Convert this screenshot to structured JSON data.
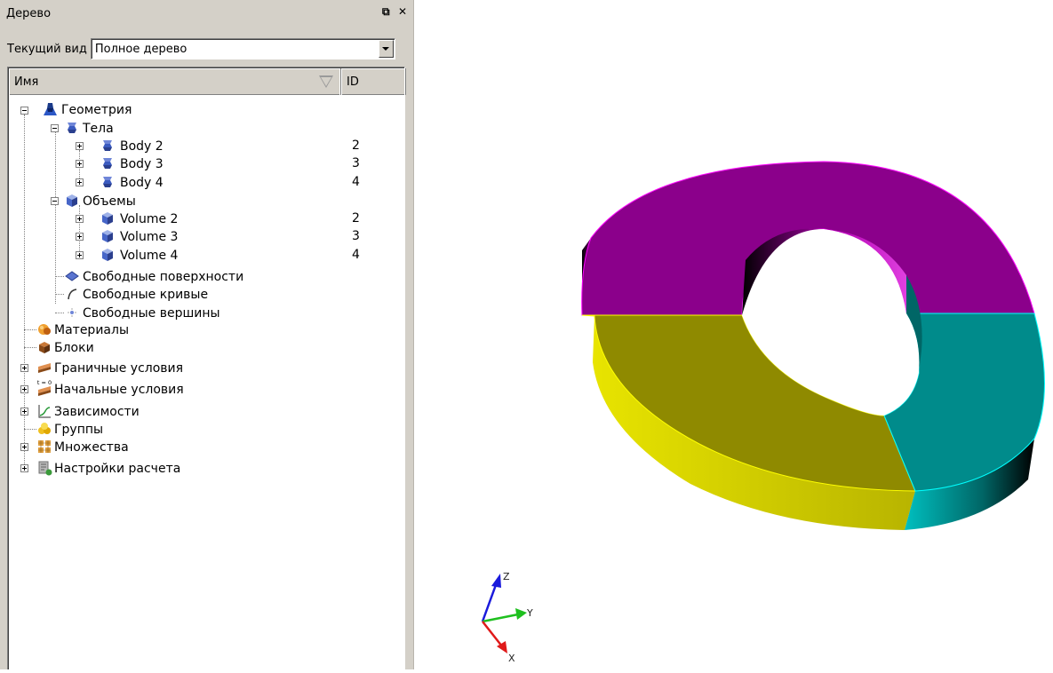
{
  "panel": {
    "title": "Дерево",
    "float_glyph": "⧉",
    "close_glyph": "✕",
    "view_label": "Текущий вид",
    "view_value": "Полное дерево"
  },
  "columns": {
    "name": "Имя",
    "id": "ID"
  },
  "tree": {
    "geometry": "Геометрия",
    "bodies": "Тела",
    "body2": {
      "label": "Body 2",
      "id": "2"
    },
    "body3": {
      "label": "Body 3",
      "id": "3"
    },
    "body4": {
      "label": "Body 4",
      "id": "4"
    },
    "volumes": "Объемы",
    "volume2": {
      "label": "Volume 2",
      "id": "2"
    },
    "volume3": {
      "label": "Volume 3",
      "id": "3"
    },
    "volume4": {
      "label": "Volume 4",
      "id": "4"
    },
    "free_surfaces": "Свободные поверхности",
    "free_curves": "Свободные кривые",
    "free_vertices": "Свободные вершины",
    "materials": "Материалы",
    "blocks": "Блоки",
    "boundary_conditions": "Граничные условия",
    "initial_conditions": "Начальные условия",
    "initial_conditions_icon_text": "t = 0",
    "dependencies": "Зависимости",
    "groups": "Группы",
    "sets": "Множества",
    "calc_settings": "Настройки расчета"
  },
  "axes": {
    "z": "Z",
    "y": "Y",
    "x": "X"
  },
  "colors": {
    "magenta": "#8b008b",
    "olive": "#8f8a00",
    "teal": "#008b8b",
    "yellow": "#dcd800",
    "panel_bg": "#d4d0c8"
  }
}
